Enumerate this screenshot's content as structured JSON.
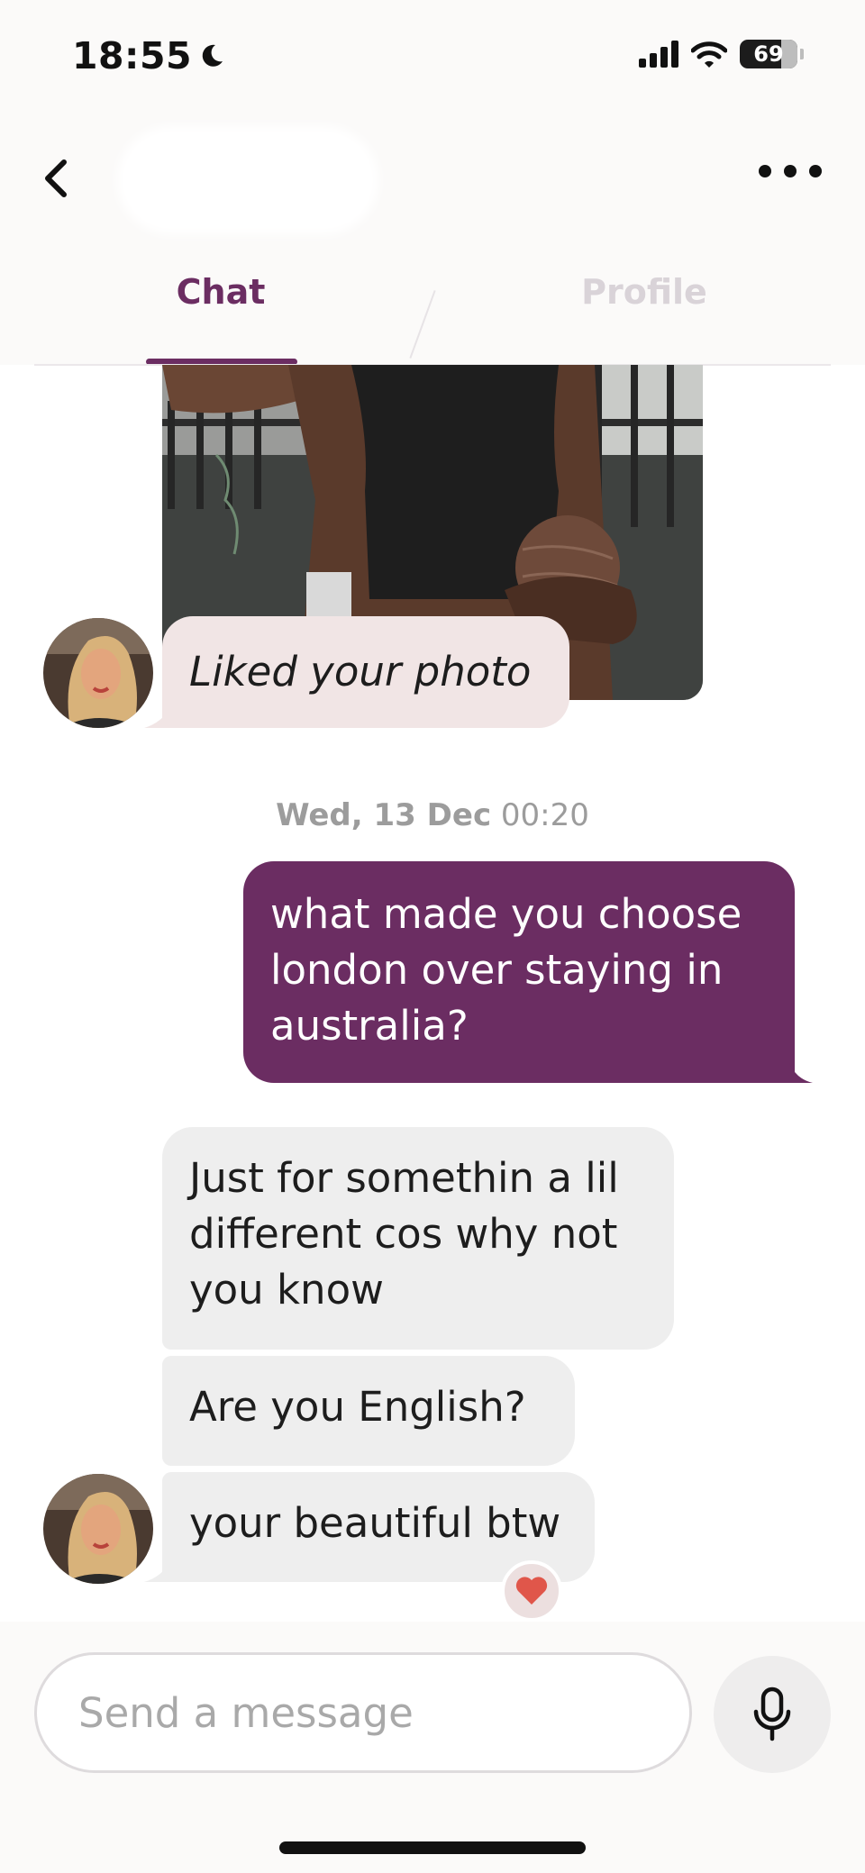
{
  "status_bar": {
    "time": "18:55",
    "battery": "69"
  },
  "header": {
    "tabs": [
      {
        "label": "Chat",
        "active": true
      },
      {
        "label": "Profile",
        "active": false
      }
    ]
  },
  "messages": {
    "liked_photo": "Liked your photo",
    "timestamp_day": "Wed, 13 Dec",
    "timestamp_time": "00:20",
    "outgoing": [
      "what made you choose",
      "london over staying in",
      "australia?"
    ],
    "incoming_1": [
      "Just for somethin a lil",
      "different cos why not",
      "you know"
    ],
    "incoming_2": "Are you English?",
    "incoming_3": "your beautiful btw",
    "reaction_icon": "heart-icon"
  },
  "composer": {
    "placeholder": "Send a message"
  },
  "colors": {
    "accent": "#6b2d62",
    "incoming_bubble": "#eeeeee",
    "liked_bubble": "#f1e5e5",
    "reaction_heart": "#e0564a"
  }
}
